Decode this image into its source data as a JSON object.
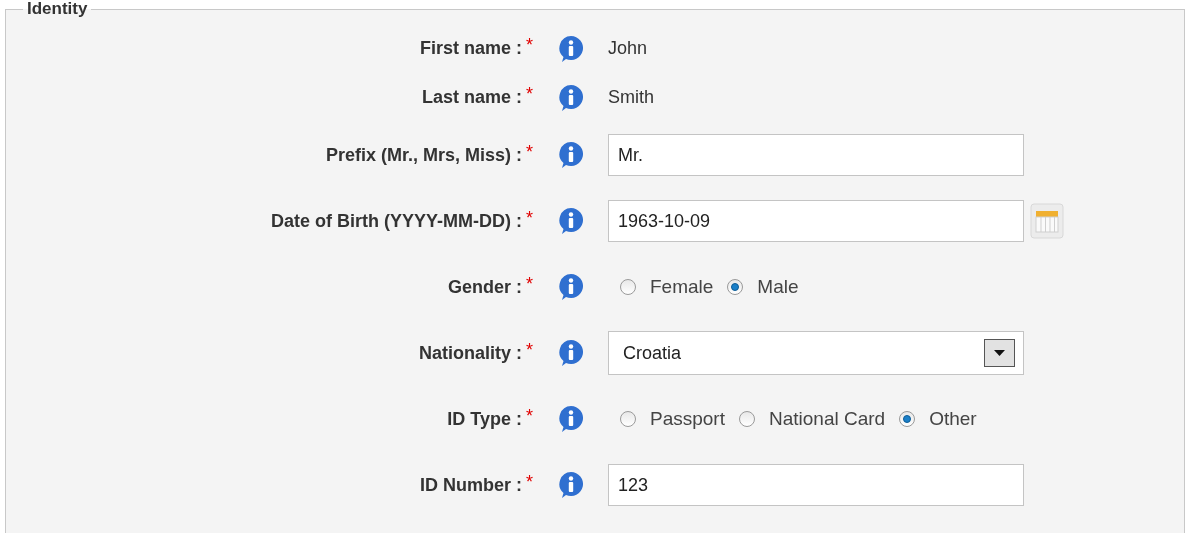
{
  "legend": "Identity",
  "fields": [
    {
      "kind": "text",
      "label": "First name :",
      "required": "*",
      "value": "John"
    },
    {
      "kind": "text",
      "label": "Last name :",
      "required": "*",
      "value": "Smith"
    },
    {
      "kind": "input",
      "label": "Prefix (Mr., Mrs, Miss) :",
      "required": "*",
      "value": "Mr."
    },
    {
      "kind": "date",
      "label": "Date of Birth (YYYY-MM-DD) :",
      "required": "*",
      "value": "1963-10-09"
    },
    {
      "kind": "radio",
      "label": "Gender :",
      "required": "*",
      "options": [
        {
          "label": "Female",
          "selected": false
        },
        {
          "label": "Male",
          "selected": true
        }
      ]
    },
    {
      "kind": "select",
      "label": "Nationality :",
      "required": "*",
      "value": "Croatia"
    },
    {
      "kind": "radio",
      "label": "ID Type :",
      "required": "*",
      "options": [
        {
          "label": "Passport",
          "selected": false
        },
        {
          "label": "National Card",
          "selected": false
        },
        {
          "label": "Other",
          "selected": true
        }
      ]
    },
    {
      "kind": "input",
      "label": "ID Number :",
      "required": "*",
      "value": "123"
    }
  ]
}
